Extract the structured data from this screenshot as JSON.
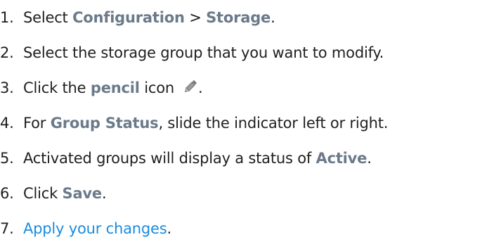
{
  "steps": [
    {
      "number": "1.",
      "before": "Select ",
      "ui1": "Configuration",
      "middle": " > ",
      "ui2": "Storage",
      "after": "."
    },
    {
      "number": "2.",
      "text": "Select the storage group that you want to modify."
    },
    {
      "number": "3.",
      "before": "Click the ",
      "ui": "pencil",
      "after": " icon",
      "icon": "pencil-icon",
      "end": "."
    },
    {
      "number": "4.",
      "before": "For ",
      "ui": "Group Status",
      "after": ", slide the indicator left or right."
    },
    {
      "number": "5.",
      "before": "Activated groups will display a status of ",
      "ui": "Active",
      "after": "."
    },
    {
      "number": "6.",
      "before": "Click ",
      "ui": "Save",
      "after": "."
    },
    {
      "number": "7.",
      "link": "Apply your changes",
      "after": "."
    }
  ],
  "colors": {
    "text": "#1f1f1f",
    "ui_label": "#6b7a8a",
    "link": "#1a8be0"
  }
}
